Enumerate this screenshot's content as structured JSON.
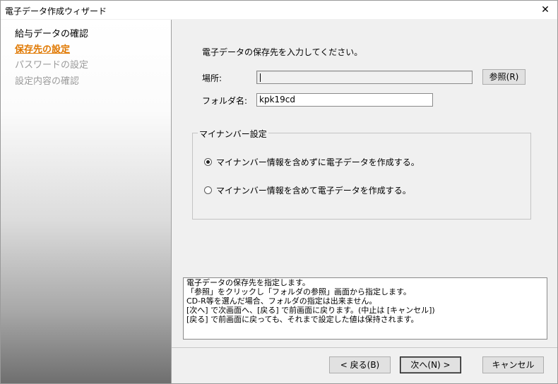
{
  "window": {
    "title": "電子データ作成ウィザード",
    "close_label": "✕"
  },
  "sidebar": {
    "items": [
      {
        "label": "給与データの確認",
        "state": "done"
      },
      {
        "label": "保存先の設定",
        "state": "active"
      },
      {
        "label": "パスワードの設定",
        "state": "pending"
      },
      {
        "label": "設定内容の確認",
        "state": "pending"
      }
    ]
  },
  "main": {
    "instruction": "電子データの保存先を入力してください。",
    "location": {
      "label": "場所:",
      "value": ""
    },
    "browse_button": "参照(R)",
    "folder": {
      "label": "フォルダ名:",
      "value": "kpk19cd"
    },
    "mynumber_group": {
      "title": "マイナンバー設定",
      "options": [
        {
          "label": "マイナンバー情報を含めずに電子データを作成する。",
          "checked": true
        },
        {
          "label": "マイナンバー情報を含めて電子データを作成する。",
          "checked": false
        }
      ]
    },
    "help_lines": [
      "電子データの保存先を指定します。",
      "「参照」をクリックし「フォルダの参照」画面から指定します。",
      "CD-R等を選んだ場合、フォルダの指定は出来ません。",
      "[次へ] で次画面へ、[戻る] で前画面に戻ります。(中止は [キャンセル])",
      "[戻る] で前画面に戻っても、それまで設定した値は保持されます。"
    ]
  },
  "footer": {
    "back_label": "< 戻る(B)",
    "next_label": "次へ(N) >",
    "cancel_label": "キャンセル"
  },
  "colors": {
    "active_step": "#e07800",
    "pending_step": "#9b9b9b"
  }
}
